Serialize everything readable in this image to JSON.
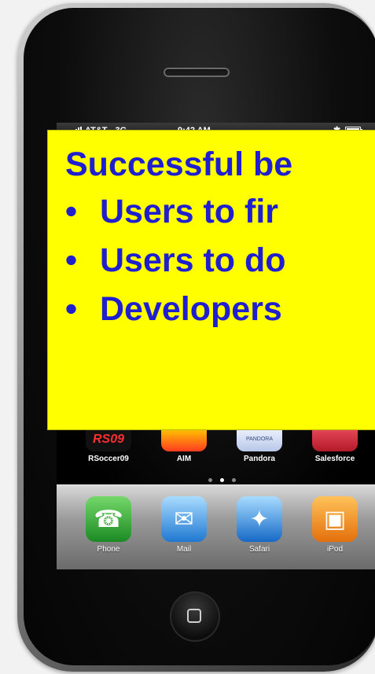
{
  "status_bar": {
    "carrier": "AT&T",
    "network": "3G",
    "time": "9:42 AM"
  },
  "home_screen": {
    "row_apps": [
      {
        "label": "RSoccer09",
        "icon": "rsoccer-icon",
        "badge": "RS09"
      },
      {
        "label": "AIM",
        "icon": "aim-icon"
      },
      {
        "label": "Pandora",
        "icon": "pandora-icon",
        "badge": "PANDORA"
      },
      {
        "label": "Salesforce",
        "icon": "salesforce-icon"
      }
    ],
    "page_dots": 3,
    "active_page": 2
  },
  "dock": {
    "apps": [
      {
        "label": "Phone",
        "icon": "phone-icon"
      },
      {
        "label": "Mail",
        "icon": "mail-icon"
      },
      {
        "label": "Safari",
        "icon": "safari-icon"
      },
      {
        "label": "iPod",
        "icon": "ipod-icon"
      }
    ]
  },
  "overlay": {
    "title": "Successful be",
    "bullets": [
      "Users to fir",
      "Users to do",
      "Developers"
    ],
    "background": "#ffff00",
    "text_color": "#1f1fd0"
  }
}
